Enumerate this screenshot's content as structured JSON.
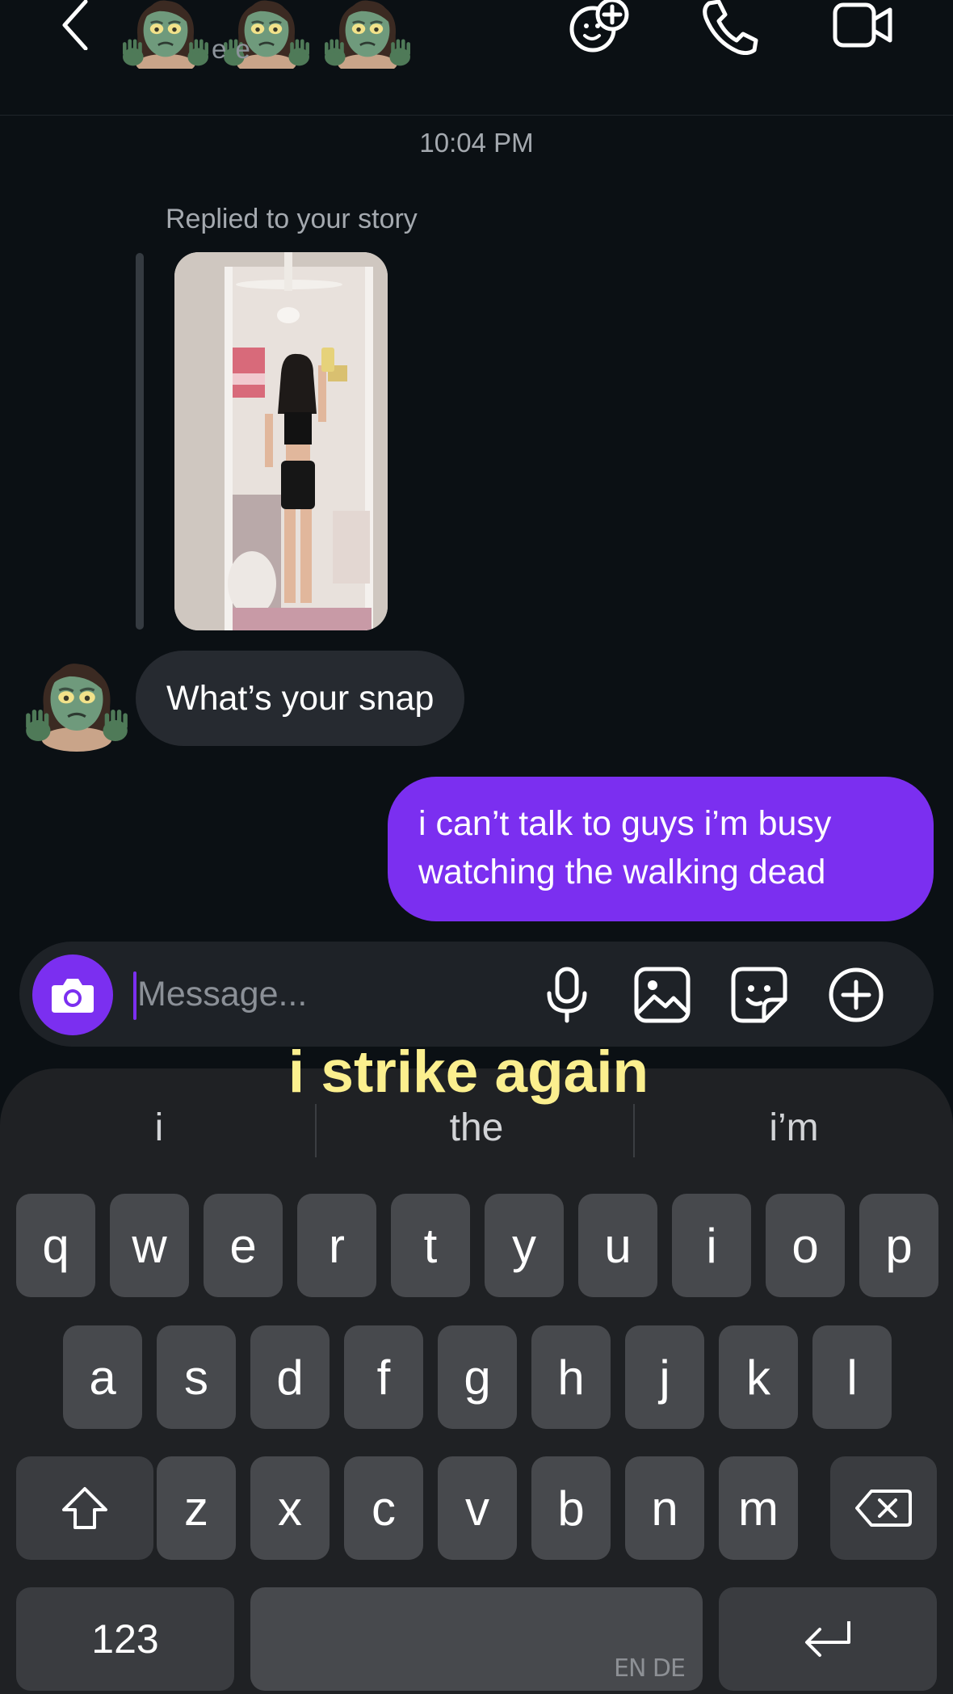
{
  "header": {
    "subtitle": "e        e",
    "icons": [
      "back-icon",
      "add-effect-icon",
      "phone-icon",
      "video-icon"
    ]
  },
  "conversation": {
    "timestamp": "10:04 PM",
    "reply_label": "Replied to your story",
    "incoming_message": "What’s your snap",
    "outgoing_message": "i can’t talk to guys i’m busy watching the walking dead"
  },
  "composer": {
    "placeholder": "Message...",
    "icons": [
      "camera-icon",
      "microphone-icon",
      "gallery-icon",
      "sticker-icon",
      "plus-icon"
    ]
  },
  "caption": "i strike again",
  "keyboard": {
    "suggestions": [
      "i",
      "the",
      "i’m"
    ],
    "row1": [
      "q",
      "w",
      "e",
      "r",
      "t",
      "y",
      "u",
      "i",
      "o",
      "p"
    ],
    "row2": [
      "a",
      "s",
      "d",
      "f",
      "g",
      "h",
      "j",
      "k",
      "l"
    ],
    "row3": [
      "z",
      "x",
      "c",
      "v",
      "b",
      "n",
      "m"
    ],
    "numbers_key": "123",
    "language_label": "EN DE"
  },
  "colors": {
    "background": "#0b1014",
    "accent": "#7b2ff0",
    "incoming_bubble": "#262a30",
    "caption": "#fbef8e"
  }
}
